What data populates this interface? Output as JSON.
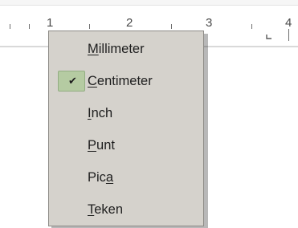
{
  "ruler": {
    "numbers": [
      "1",
      "2",
      "3",
      "4"
    ]
  },
  "menu": {
    "items": [
      {
        "label": "Millimeter",
        "mnemonic_index": 0,
        "checked": false
      },
      {
        "label": "Centimeter",
        "mnemonic_index": 0,
        "checked": true
      },
      {
        "label": "Inch",
        "mnemonic_index": 0,
        "checked": false
      },
      {
        "label": "Punt",
        "mnemonic_index": 0,
        "checked": false
      },
      {
        "label": "Pica",
        "mnemonic_index": 3,
        "checked": false
      },
      {
        "label": "Teken",
        "mnemonic_index": 0,
        "checked": false
      }
    ]
  },
  "icons": {
    "check": "checkmark-icon"
  },
  "colors": {
    "menu_background": "#d5d2cc",
    "check_highlight": "#b5cba2",
    "ruler_tick": "#6e6e6e"
  }
}
